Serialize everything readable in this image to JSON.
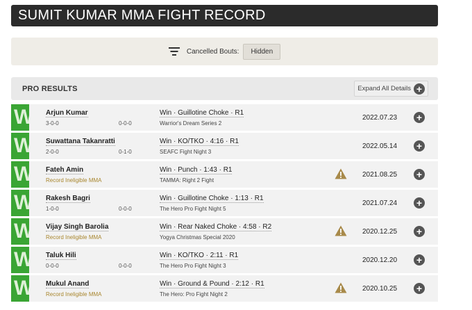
{
  "page": {
    "title": "SUMIT KUMAR MMA FIGHT RECORD"
  },
  "filter": {
    "label": "Cancelled Bouts:",
    "value": "Hidden"
  },
  "section": {
    "title": "PRO RESULTS",
    "expand_label": "Expand All Details"
  },
  "colors": {
    "win": "#3aa534",
    "warning": "#a8862e",
    "header_bg": "#2b2b2b"
  },
  "fights": [
    {
      "outcome": "W",
      "opponent": "Arjun Kumar",
      "record": "3-0-0",
      "record2": "0-0-0",
      "ineligible": false,
      "result": "Win · Guillotine Choke · R1",
      "event": "Warrior's Dream Series 2",
      "warning": false,
      "date": "2022.07.23"
    },
    {
      "outcome": "W",
      "opponent": "Suwattana Takanratti",
      "record": "2-0-0",
      "record2": "0-1-0",
      "ineligible": false,
      "result": "Win · KO/TKO · 4:16 · R1",
      "event": "SEAFC Fight Night 3",
      "warning": false,
      "date": "2022.05.14"
    },
    {
      "outcome": "W",
      "opponent": "Fateh Amin",
      "record": "Record Ineligible MMA",
      "record2": "",
      "ineligible": true,
      "result": "Win · Punch · 1:43 · R1",
      "event": "TAMMA: Right 2 Fight",
      "warning": true,
      "date": "2021.08.25"
    },
    {
      "outcome": "W",
      "opponent": "Rakesh Bagri",
      "record": "1-0-0",
      "record2": "0-0-0",
      "ineligible": false,
      "result": "Win · Guillotine Choke · 1:13 · R1",
      "event": "The Hero Pro Fight Night 5",
      "warning": false,
      "date": "2021.07.24"
    },
    {
      "outcome": "W",
      "opponent": "Vijay Singh Barolia",
      "record": "Record Ineligible MMA",
      "record2": "",
      "ineligible": true,
      "result": "Win · Rear Naked Choke · 4:58 · R2",
      "event": "Yogya Christmas Special 2020",
      "warning": true,
      "date": "2020.12.25"
    },
    {
      "outcome": "W",
      "opponent": "Taluk Hili",
      "record": "0-0-0",
      "record2": "0-0-0",
      "ineligible": false,
      "result": "Win · KO/TKO · 2:11 · R1",
      "event": "The Hero Pro Fight Night 3",
      "warning": false,
      "date": "2020.12.20"
    },
    {
      "outcome": "W",
      "opponent": "Mukul Anand",
      "record": "Record Ineligible MMA",
      "record2": "",
      "ineligible": true,
      "result": "Win · Ground & Pound · 2:12 · R1",
      "event": "The Hero: Pro Fight Night 2",
      "warning": true,
      "date": "2020.10.25"
    }
  ]
}
